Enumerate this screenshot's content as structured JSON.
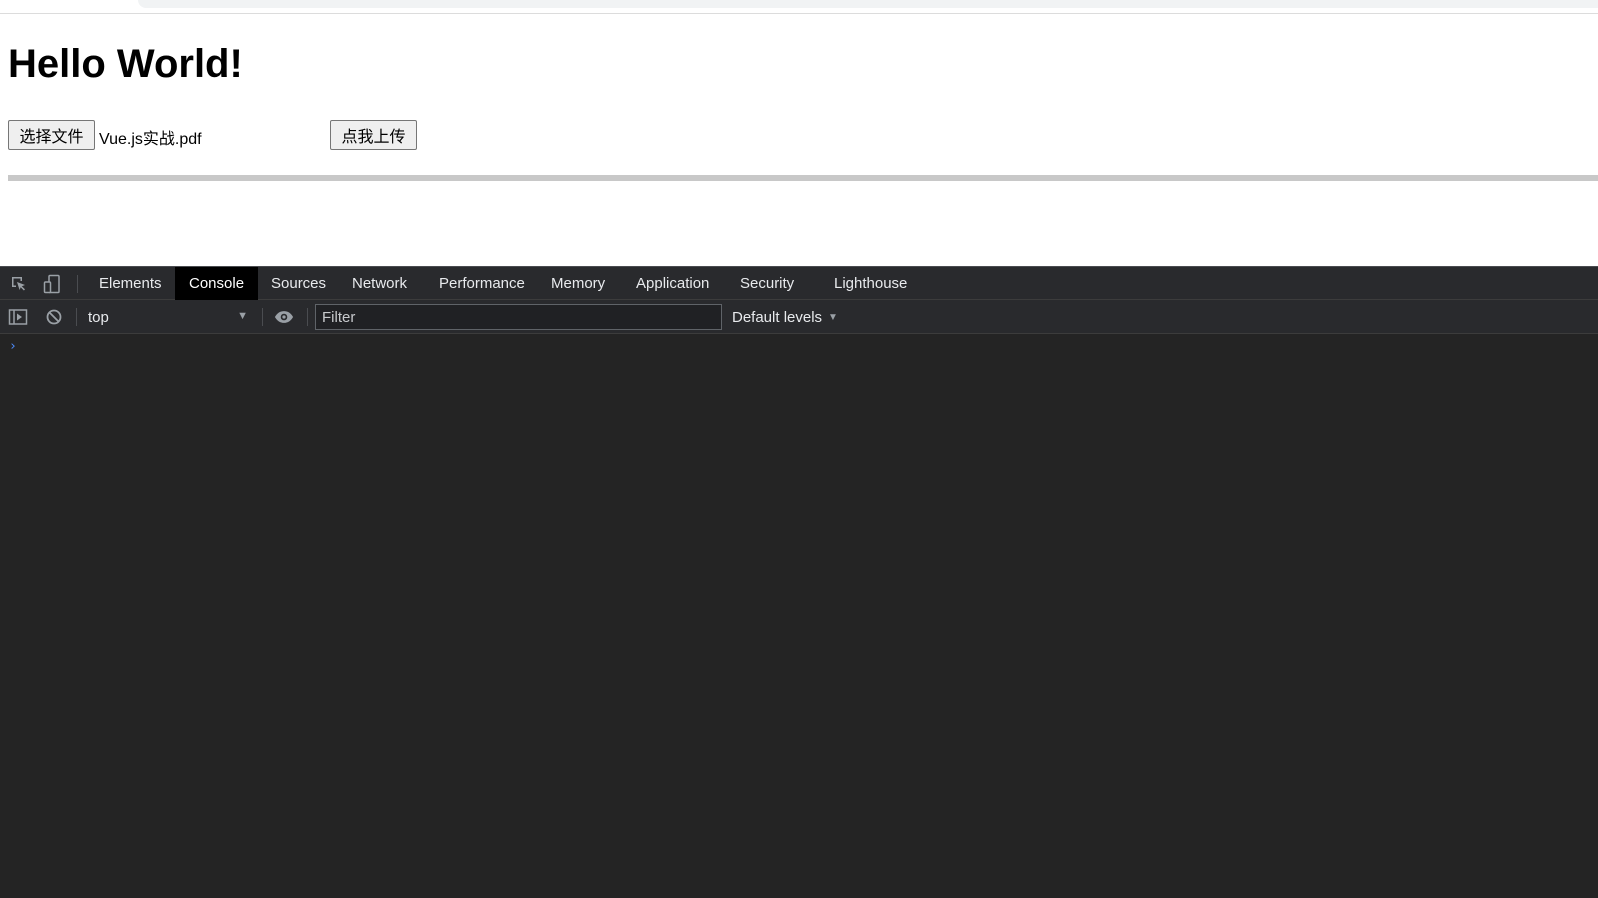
{
  "page": {
    "title": "Hello World!",
    "file_button_label": "选择文件",
    "file_name": "Vue.js实战.pdf",
    "upload_button_label": "点我上传",
    "progress_percent": 0
  },
  "devtools": {
    "tabs": [
      {
        "label": "Elements",
        "active": false
      },
      {
        "label": "Console",
        "active": true
      },
      {
        "label": "Sources",
        "active": false
      },
      {
        "label": "Network",
        "active": false
      },
      {
        "label": "Performance",
        "active": false
      },
      {
        "label": "Memory",
        "active": false
      },
      {
        "label": "Application",
        "active": false
      },
      {
        "label": "Security",
        "active": false
      },
      {
        "label": "Lighthouse",
        "active": false
      }
    ],
    "toolbar": {
      "context": "top",
      "filter_placeholder": "Filter",
      "filter_value": "",
      "levels_label": "Default levels"
    },
    "console": {
      "prompt": "›"
    },
    "icons": {
      "inspect": "inspect-element-icon",
      "device": "device-toolbar-icon",
      "sidebar": "show-sidebar-icon",
      "clear": "clear-console-icon",
      "eye": "live-expression-eye-icon"
    },
    "colors": {
      "background": "#242424",
      "panel": "#292a2d",
      "active_tab": "#000000",
      "prompt": "#4d8dff"
    }
  }
}
